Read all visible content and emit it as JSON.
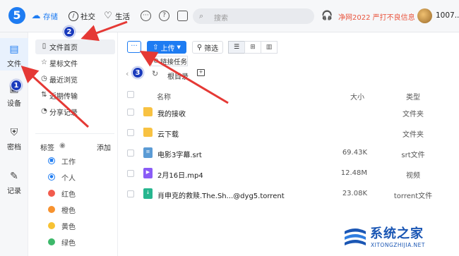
{
  "nav": {
    "storage": "存储",
    "social": "社交",
    "life": "生活"
  },
  "search": {
    "placeholder": "搜索"
  },
  "promo": "净网2022 严打不良信息",
  "user": {
    "name": "1007..."
  },
  "rail": [
    {
      "label": "文件",
      "icon": "file-icon"
    },
    {
      "label": "设备",
      "icon": "device-icon"
    },
    {
      "label": "密档",
      "icon": "shield-icon"
    },
    {
      "label": "记录",
      "icon": "pen-icon"
    }
  ],
  "sidebar": {
    "items": [
      {
        "label": "文件首页",
        "icon": "file-icon"
      },
      {
        "label": "星标文件",
        "icon": "star-icon"
      },
      {
        "label": "最近浏览",
        "icon": "clock-icon"
      },
      {
        "label": "近期传输",
        "icon": "transfer-icon"
      },
      {
        "label": "分享记录",
        "icon": "share-icon"
      }
    ],
    "tags_header": "标签",
    "tags_add": "添加",
    "tags": [
      {
        "label": "工作",
        "color": "#1e7cf2"
      },
      {
        "label": "个人",
        "color": "#1e7cf2"
      },
      {
        "label": "红色",
        "color": "#f25b4d"
      },
      {
        "label": "橙色",
        "color": "#f7922e"
      },
      {
        "label": "黄色",
        "color": "#f7c233"
      },
      {
        "label": "绿色",
        "color": "#3db86a"
      }
    ]
  },
  "toolbar": {
    "upload_label": "上传",
    "filter_label": "筛选",
    "tooltip": "链接任务"
  },
  "breadcrumb": {
    "current": "根目录"
  },
  "table": {
    "headers": {
      "name": "名称",
      "size": "大小",
      "type": "类型"
    },
    "rows": [
      {
        "name": "我的接收",
        "size": "",
        "type": "文件夹",
        "kind": "folder"
      },
      {
        "name": "云下载",
        "size": "",
        "type": "文件夹",
        "kind": "folder"
      },
      {
        "name": "电影3字幕.srt",
        "size": "69.43K",
        "type": "srt文件",
        "kind": "srt"
      },
      {
        "name": "2月16日.mp4",
        "size": "12.48M",
        "type": "视频",
        "kind": "mp4"
      },
      {
        "name": "肖申克的救赎.The.Sh...@dyg5.torrent",
        "size": "23.08K",
        "type": "torrent文件",
        "kind": "torrent"
      }
    ]
  },
  "annotations": {
    "badges": [
      "1",
      "2",
      "3"
    ],
    "arrow_color": "#e53935"
  },
  "watermark": {
    "main": "系统之家",
    "sub": "XITONGZHIJIA.NET"
  },
  "colors": {
    "accent": "#1e7cf2",
    "promo": "#e9543d"
  }
}
